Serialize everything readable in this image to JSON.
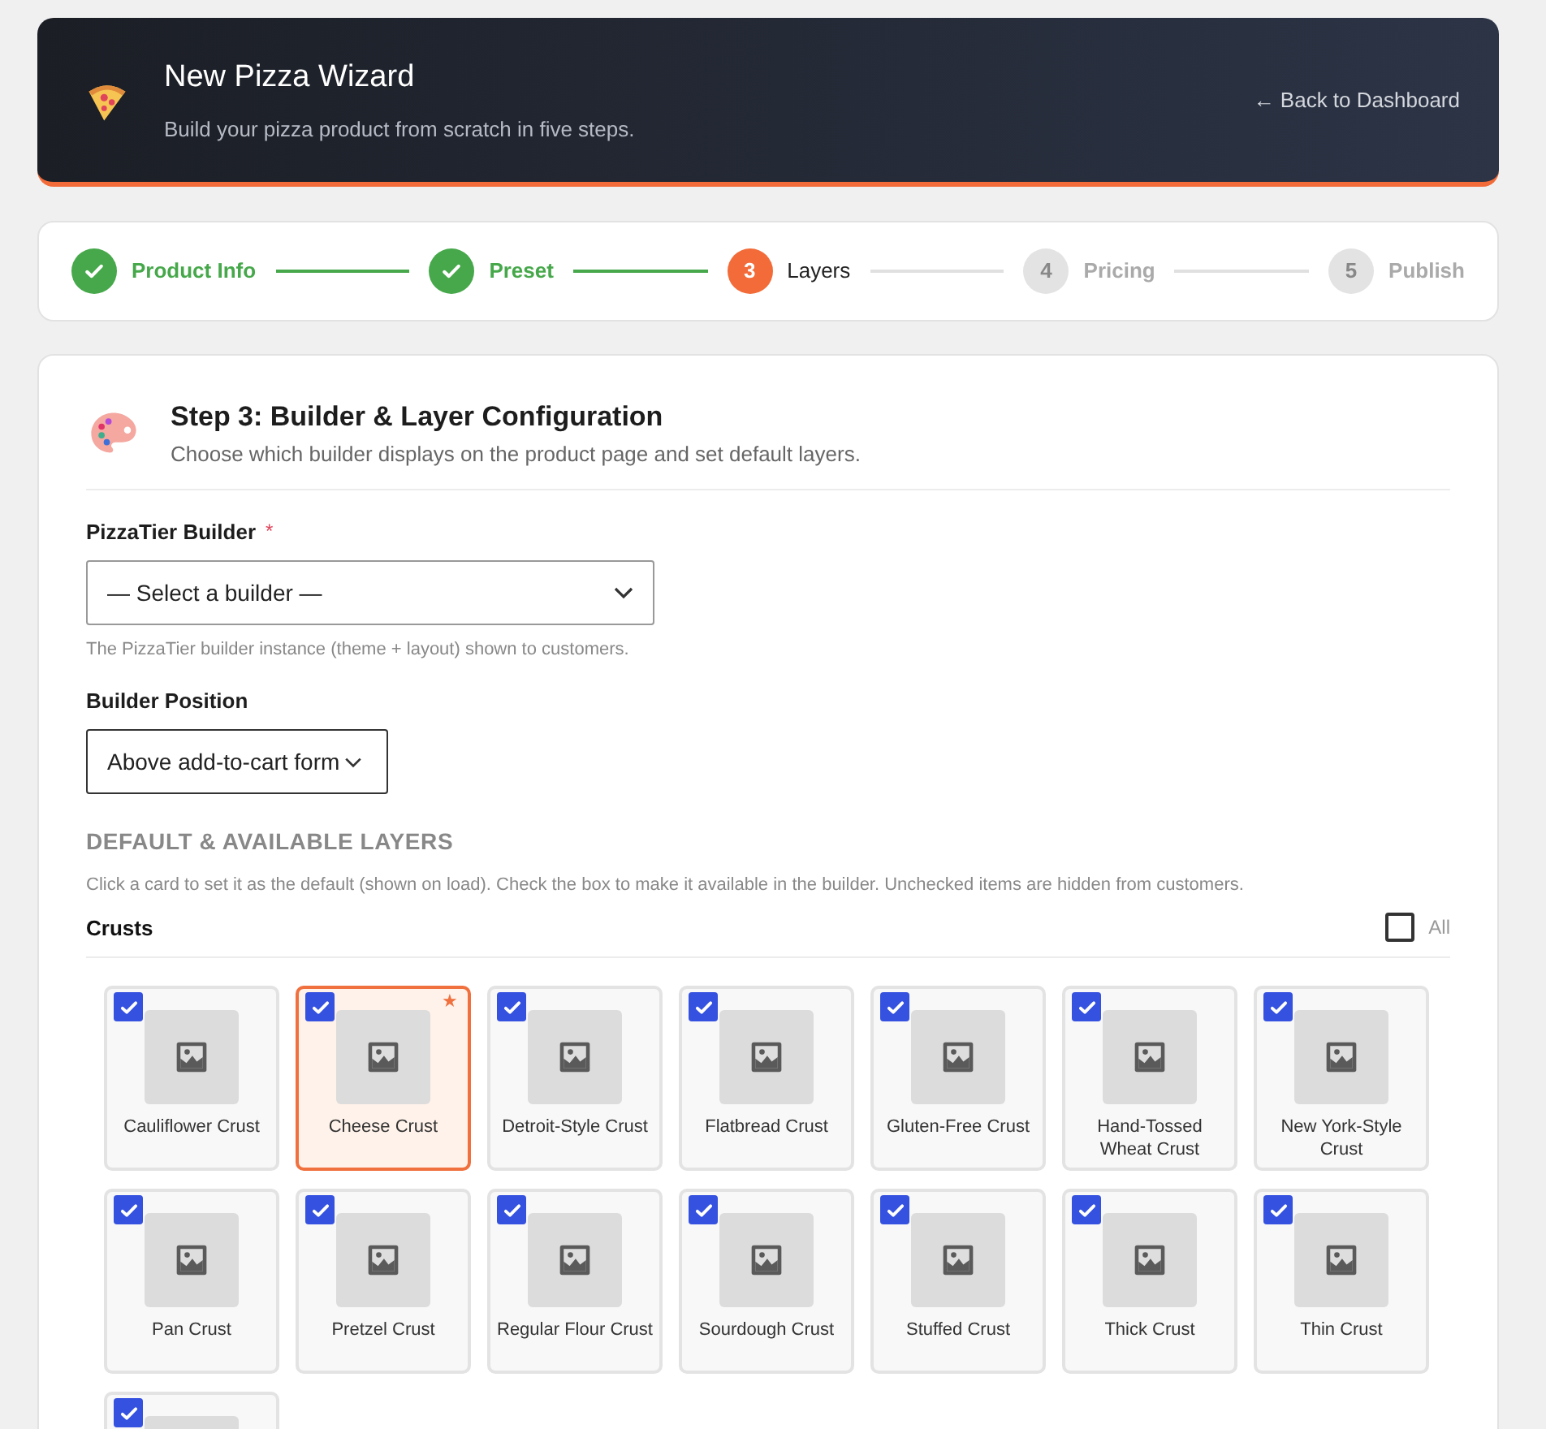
{
  "header": {
    "title": "New Pizza Wizard",
    "subtitle": "Build your pizza product from scratch in five steps.",
    "back_link": "← Back to Dashboard"
  },
  "steps": [
    {
      "label": "Product Info",
      "done": true,
      "selected": false
    },
    {
      "label": "Preset",
      "done": true,
      "selected": false
    },
    {
      "number": "3",
      "label": "Layers",
      "done": false,
      "selected": true
    },
    {
      "number": "4",
      "label": "Pricing",
      "done": false,
      "selected": false
    },
    {
      "number": "5",
      "label": "Publish",
      "done": false,
      "selected": false
    }
  ],
  "section": {
    "title": "Step 3: Builder & Layer Configuration",
    "subtitle": "Choose which builder displays on the product page and set default layers."
  },
  "builder_field": {
    "label": "PizzaTier Builder",
    "required_mark": "*",
    "value": "— Select a builder —",
    "help": "The PizzaTier builder instance (theme + layout) shown to customers."
  },
  "position_field": {
    "label": "Builder Position",
    "value": "Above add-to-cart form"
  },
  "layers": {
    "heading": "DEFAULT & AVAILABLE LAYERS",
    "description": "Click a card to set it as the default (shown on load). Check the box to make it available in the builder. Unchecked items are hidden from customers.",
    "group": "Crusts",
    "all_label": "All",
    "all_checked": false,
    "default_mark": "★",
    "items": [
      {
        "name": "Cauliflower Crust",
        "checked": true,
        "selected": false
      },
      {
        "name": "Cheese Crust",
        "checked": true,
        "selected": true
      },
      {
        "name": "Detroit-Style Crust",
        "checked": true,
        "selected": false
      },
      {
        "name": "Flatbread Crust",
        "checked": true,
        "selected": false
      },
      {
        "name": "Gluten-Free Crust",
        "checked": true,
        "selected": false
      },
      {
        "name": "Hand-Tossed Wheat Crust",
        "checked": true,
        "selected": false
      },
      {
        "name": "New York-Style Crust",
        "checked": true,
        "selected": false
      },
      {
        "name": "Pan Crust",
        "checked": true,
        "selected": false
      },
      {
        "name": "Pretzel Crust",
        "checked": true,
        "selected": false
      },
      {
        "name": "Regular Flour Crust",
        "checked": true,
        "selected": false
      },
      {
        "name": "Sourdough Crust",
        "checked": true,
        "selected": false
      },
      {
        "name": "Stuffed Crust",
        "checked": true,
        "selected": false
      },
      {
        "name": "Thick Crust",
        "checked": true,
        "selected": false
      },
      {
        "name": "Thin Crust",
        "checked": true,
        "selected": false
      },
      {
        "checked": true,
        "selected": false
      }
    ]
  }
}
